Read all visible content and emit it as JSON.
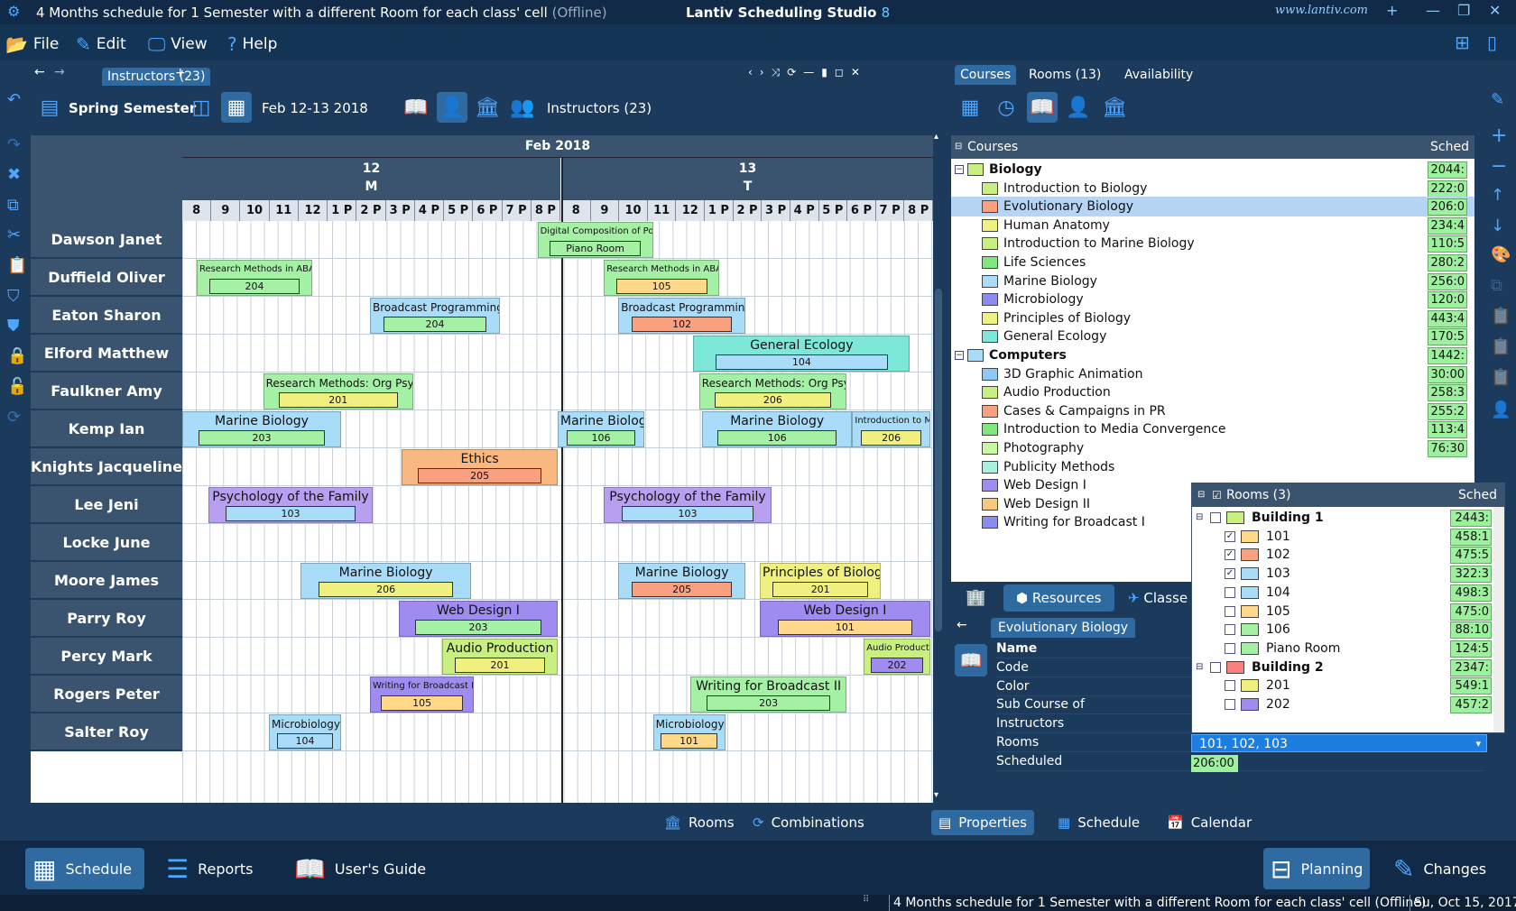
{
  "window": {
    "doc_title": "4 Months schedule for 1 Semester with a different Room for each class' cell",
    "offline": "(Offline)",
    "app_title": "Lantiv Scheduling Studio",
    "app_version": "8",
    "url": "www.lantiv.com"
  },
  "menu": [
    {
      "label": "File",
      "icon": "folder-icon"
    },
    {
      "label": "Edit",
      "icon": "pencil-icon"
    },
    {
      "label": "View",
      "icon": "monitor-icon"
    },
    {
      "label": "Help",
      "icon": "question-icon"
    }
  ],
  "left_tab": {
    "label": "Instructors (23)"
  },
  "toolbar": {
    "semester": "Spring Semester",
    "date": "Feb 12-13 2018",
    "view_label": "Instructors (23)"
  },
  "grid": {
    "month": "Feb 2018",
    "days": [
      {
        "num": "12",
        "dow": "M"
      },
      {
        "num": "13",
        "dow": "T"
      }
    ],
    "hours": [
      "8",
      "9",
      "10",
      "11",
      "12",
      "1 P",
      "2 P",
      "3 P",
      "4 P",
      "5 P",
      "6 P",
      "7 P",
      "8 P"
    ],
    "instructors": [
      "Dawson Janet",
      "Duffield Oliver",
      "Eaton Sharon",
      "Elford Matthew",
      "Faulkner Amy",
      "Kemp Ian",
      "Knights Jacqueline",
      "Lee Jeni",
      "Locke June",
      "Moore James",
      "Parry Roy",
      "Percy Mark",
      "Rogers Peter",
      "Salter Roy"
    ],
    "events": [
      {
        "row": 0,
        "start": 12.3,
        "end": 16.3,
        "name": "Digital Composition of Pop Mu",
        "room": "Piano Room",
        "color": "#a4f0a4",
        "room_color": "#a4f0a4",
        "size": "s"
      },
      {
        "row": 1,
        "start": 0.5,
        "end": 4.5,
        "name": "Research Methods in ABA",
        "room": "204",
        "color": "#a4f0a4",
        "room_color": "#a4f0a4",
        "size": "s"
      },
      {
        "row": 1,
        "start": 14.6,
        "end": 18.6,
        "name": "Research Methods in ABA",
        "room": "105",
        "color": "#a4f0a4",
        "room_color": "#ffd88a",
        "size": "s"
      },
      {
        "row": 2,
        "start": 6.5,
        "end": 11,
        "name": "Broadcast Programming",
        "room": "204",
        "color": "#a8dcf8",
        "room_color": "#a4f0a4",
        "size": "m"
      },
      {
        "row": 2,
        "start": 15.1,
        "end": 19.5,
        "name": "Broadcast Programming",
        "room": "102",
        "color": "#a8dcf8",
        "room_color": "#f8a080",
        "size": "m"
      },
      {
        "row": 3,
        "start": 17.7,
        "end": 25.2,
        "name": "General Ecology",
        "room": "104",
        "color": "#7ee8d8",
        "room_color": "#a8dcf8",
        "size": "l"
      },
      {
        "row": 4,
        "start": 2.8,
        "end": 8,
        "name": "Research Methods: Org Psy",
        "room": "201",
        "color": "#a4f0a4",
        "room_color": "#f0f080",
        "size": "m"
      },
      {
        "row": 4,
        "start": 17.9,
        "end": 23,
        "name": "Research Methods: Org Psy",
        "room": "206",
        "color": "#a4f0a4",
        "room_color": "#f0f080",
        "size": "m"
      },
      {
        "row": 5,
        "start": 0,
        "end": 5.5,
        "name": "Marine Biology",
        "room": "203",
        "color": "#a8dcf8",
        "room_color": "#a4f0a4",
        "size": "l"
      },
      {
        "row": 5,
        "start": 13,
        "end": 16,
        "name": "Marine Biology",
        "room": "106",
        "color": "#a8dcf8",
        "room_color": "#a4f0a4",
        "size": "l"
      },
      {
        "row": 5,
        "start": 18,
        "end": 23.2,
        "name": "Marine Biology",
        "room": "106",
        "color": "#a8dcf8",
        "room_color": "#a4f0a4",
        "size": "l"
      },
      {
        "row": 5,
        "start": 23.2,
        "end": 25.9,
        "name": "Introduction to M",
        "room": "206",
        "color": "#a8dcf8",
        "room_color": "#f0f080",
        "size": "s"
      },
      {
        "row": 6,
        "start": 7.6,
        "end": 13,
        "name": "Ethics",
        "room": "205",
        "color": "#f8b880",
        "room_color": "#f8a080",
        "size": "l"
      },
      {
        "row": 7,
        "start": 0.9,
        "end": 6.6,
        "name": "Psychology of the Family",
        "room": "103",
        "color": "#b8a0f0",
        "room_color": "#a8dcf8",
        "size": "l"
      },
      {
        "row": 7,
        "start": 14.6,
        "end": 20.4,
        "name": "Psychology of the Family",
        "room": "103",
        "color": "#b8a0f0",
        "room_color": "#a8dcf8",
        "size": "l"
      },
      {
        "row": 9,
        "start": 4.1,
        "end": 10,
        "name": "Marine Biology",
        "room": "206",
        "color": "#a8dcf8",
        "room_color": "#f0f080",
        "size": "l"
      },
      {
        "row": 9,
        "start": 15.1,
        "end": 19.5,
        "name": "Marine Biology",
        "room": "205",
        "color": "#a8dcf8",
        "room_color": "#f8a080",
        "size": "l"
      },
      {
        "row": 9,
        "start": 20,
        "end": 24.2,
        "name": "Principles of Biology",
        "room": "201",
        "color": "#f0f080",
        "room_color": "#f0f080",
        "size": "l"
      },
      {
        "row": 10,
        "start": 7.5,
        "end": 13,
        "name": "Web Design I",
        "room": "203",
        "color": "#a08cf0",
        "room_color": "#a4f0a4",
        "size": "l"
      },
      {
        "row": 10,
        "start": 20,
        "end": 25.9,
        "name": "Web Design I",
        "room": "101",
        "color": "#a08cf0",
        "room_color": "#ffd88a",
        "size": "l"
      },
      {
        "row": 11,
        "start": 9,
        "end": 13,
        "name": "Audio Production",
        "room": "201",
        "color": "#c8f080",
        "room_color": "#f0f080",
        "size": "l"
      },
      {
        "row": 11,
        "start": 23.6,
        "end": 25.9,
        "name": "Audio Productio",
        "room": "202",
        "color": "#c8f080",
        "room_color": "#a08cf0",
        "size": "s"
      },
      {
        "row": 12,
        "start": 6.5,
        "end": 10.1,
        "name": "Writing for Broadcast I",
        "room": "105",
        "color": "#a08cf0",
        "room_color": "#ffd88a",
        "size": "s"
      },
      {
        "row": 12,
        "start": 17.6,
        "end": 23,
        "name": "Writing for Broadcast II",
        "room": "203",
        "color": "#a4f0a4",
        "room_color": "#a4f0a4",
        "size": "l"
      },
      {
        "row": 13,
        "start": 3,
        "end": 5.5,
        "name": "Microbiology",
        "room": "104",
        "color": "#a8dcf8",
        "room_color": "#a8dcf8",
        "size": "m"
      },
      {
        "row": 13,
        "start": 16.3,
        "end": 18.8,
        "name": "Microbiology",
        "room": "101",
        "color": "#a8dcf8",
        "room_color": "#ffd88a",
        "size": "m"
      }
    ]
  },
  "right_tabs": [
    {
      "label": "Courses",
      "active": true
    },
    {
      "label": "Rooms (13)",
      "active": false
    },
    {
      "label": "Availability",
      "active": false
    }
  ],
  "courses": {
    "header_name": "Courses",
    "header_sched": "Sched",
    "rows": [
      {
        "label": "Biology",
        "color": "#c8f080",
        "sched": "2044:",
        "group": true,
        "sel": false
      },
      {
        "label": "Introduction to Biology",
        "color": "#c8f080",
        "sched": "222:0",
        "group": false,
        "sel": false
      },
      {
        "label": "Evolutionary Biology",
        "color": "#f8a080",
        "sched": "206:0",
        "group": false,
        "sel": true
      },
      {
        "label": "Human Anatomy",
        "color": "#f0f080",
        "sched": "234:4",
        "group": false,
        "sel": false
      },
      {
        "label": "Introduction to Marine Biology",
        "color": "#c8f080",
        "sched": "110:5",
        "group": false,
        "sel": false
      },
      {
        "label": "Life Sciences",
        "color": "#7ee87e",
        "sched": "280:2",
        "group": false,
        "sel": false
      },
      {
        "label": "Marine Biology",
        "color": "#a8dcf8",
        "sched": "256:0",
        "group": false,
        "sel": false
      },
      {
        "label": "Microbiology",
        "color": "#8c8cf0",
        "sched": "120:0",
        "group": false,
        "sel": false
      },
      {
        "label": "Principles of Biology",
        "color": "#f0f080",
        "sched": "443:4",
        "group": false,
        "sel": false
      },
      {
        "label": "General Ecology",
        "color": "#7ee8d8",
        "sched": "170:5",
        "group": false,
        "sel": false
      },
      {
        "label": "Computers",
        "color": "#a8dcf8",
        "sched": "1442:",
        "group": true,
        "sel": false
      },
      {
        "label": "3D Graphic Animation",
        "color": "#8cc8f8",
        "sched": "30:00",
        "group": false,
        "sel": false
      },
      {
        "label": "Audio Production",
        "color": "#c8f080",
        "sched": "258:3",
        "group": false,
        "sel": false
      },
      {
        "label": "Cases & Campaigns in PR",
        "color": "#f8a080",
        "sched": "255:2",
        "group": false,
        "sel": false
      },
      {
        "label": "Introduction to Media Convergence",
        "color": "#7ee87e",
        "sched": "113:4",
        "group": false,
        "sel": false
      },
      {
        "label": "Photography",
        "color": "#c8f8a0",
        "sched": "76:30",
        "group": false,
        "sel": false
      },
      {
        "label": "Publicity Methods",
        "color": "#a8f0e0",
        "sched": "",
        "group": false,
        "sel": false
      },
      {
        "label": "Web Design I",
        "color": "#a08cf0",
        "sched": "",
        "group": false,
        "sel": false
      },
      {
        "label": "Web Design II",
        "color": "#f8c880",
        "sched": "",
        "group": false,
        "sel": false
      },
      {
        "label": "Writing for Broadcast I",
        "color": "#8c8cf0",
        "sched": "",
        "group": false,
        "sel": false
      }
    ]
  },
  "resource_tabs": {
    "resources": "Resources",
    "classes": "Classe"
  },
  "properties": {
    "title": "Evolutionary Biology",
    "fields": [
      "Name",
      "Code",
      "Color",
      "Sub Course of",
      "Instructors",
      "Rooms",
      "Scheduled"
    ],
    "rooms_value": "101, 102, 103",
    "scheduled_value": "206:00"
  },
  "rooms_popup": {
    "header": "Rooms (3)",
    "sched": "Sched",
    "rows": [
      {
        "label": "Building 1",
        "color": "#c8f080",
        "sched": "2443:",
        "group": true,
        "checked": false
      },
      {
        "label": "101",
        "color": "#ffd88a",
        "sched": "458:1",
        "group": false,
        "checked": true
      },
      {
        "label": "102",
        "color": "#f8a080",
        "sched": "475:5",
        "group": false,
        "checked": true
      },
      {
        "label": "103",
        "color": "#a8dcf8",
        "sched": "322:3",
        "group": false,
        "checked": true
      },
      {
        "label": "104",
        "color": "#a8dcf8",
        "sched": "498:3",
        "group": false,
        "checked": false
      },
      {
        "label": "105",
        "color": "#ffd88a",
        "sched": "475:0",
        "group": false,
        "checked": false
      },
      {
        "label": "106",
        "color": "#a4f0a4",
        "sched": "88:10",
        "group": false,
        "checked": false
      },
      {
        "label": "Piano Room",
        "color": "#a4f0a4",
        "sched": "124:5",
        "group": false,
        "checked": false
      },
      {
        "label": "Building 2",
        "color": "#f88080",
        "sched": "2347:",
        "group": true,
        "checked": false
      },
      {
        "label": "201",
        "color": "#f0f080",
        "sched": "549:1",
        "group": false,
        "checked": false
      },
      {
        "label": "202",
        "color": "#a08cf0",
        "sched": "457:2",
        "group": false,
        "checked": false
      }
    ]
  },
  "subbar": {
    "rooms": "Rooms",
    "combinations": "Combinations",
    "properties": "Properties",
    "schedule": "Schedule",
    "calendar": "Calendar"
  },
  "bottombar": {
    "schedule": "Schedule",
    "reports": "Reports",
    "guide": "User's Guide",
    "planning": "Planning",
    "changes": "Changes"
  },
  "status": {
    "doc": "4 Months schedule for 1 Semester with a different Room for each class' cell (Offline)",
    "date": "Su, Oct 15, 2017"
  }
}
